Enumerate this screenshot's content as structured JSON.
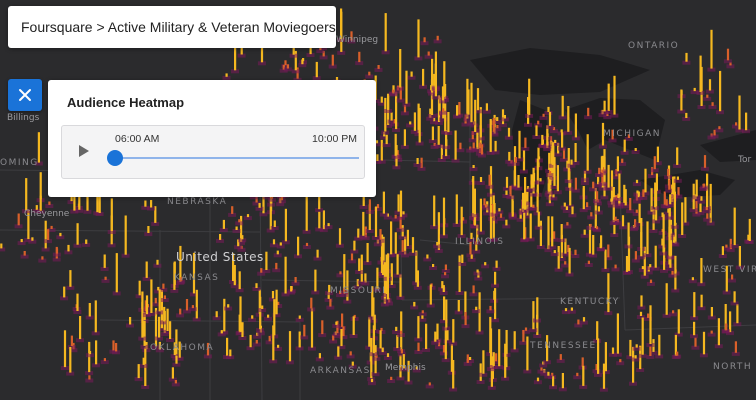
{
  "app": {
    "breadcrumb": "Foursquare > Active Military & Veteran Moviegoers"
  },
  "panel": {
    "title": "Audience Heatmap",
    "start_time": "06:00 AM",
    "end_time": "10:00 PM",
    "progress": 0.0
  },
  "map": {
    "labels": [
      {
        "text": "Winnipeg",
        "kind": "city"
      },
      {
        "text": "ONTARIO",
        "kind": "region"
      },
      {
        "text": "MICHIGAN",
        "kind": "region"
      },
      {
        "text": "Tor",
        "kind": "city"
      },
      {
        "text": "OMING",
        "kind": "region"
      },
      {
        "text": "Cheyenne",
        "kind": "city"
      },
      {
        "text": "NEBRASKA",
        "kind": "region"
      },
      {
        "text": "United States",
        "kind": "big"
      },
      {
        "text": "KANSAS",
        "kind": "region"
      },
      {
        "text": "MISSOURI",
        "kind": "region"
      },
      {
        "text": "ILLINOIS",
        "kind": "region"
      },
      {
        "text": "KENTUCKY",
        "kind": "region"
      },
      {
        "text": "WEST VIRGINIA",
        "kind": "region"
      },
      {
        "text": "OKLAHOMA",
        "kind": "region"
      },
      {
        "text": "ARKANSAS",
        "kind": "region"
      },
      {
        "text": "TENNESSEE",
        "kind": "region"
      },
      {
        "text": "NORTH CARO",
        "kind": "region"
      },
      {
        "text": "Memphis",
        "kind": "city"
      },
      {
        "text": "Billings",
        "kind": "city"
      }
    ],
    "colors": {
      "background": "#2b2b2d",
      "heat_low": "#7a1a5a",
      "heat_mid": "#d9602a",
      "heat_high": "#f5b820",
      "accent": "#1a73d8"
    }
  }
}
